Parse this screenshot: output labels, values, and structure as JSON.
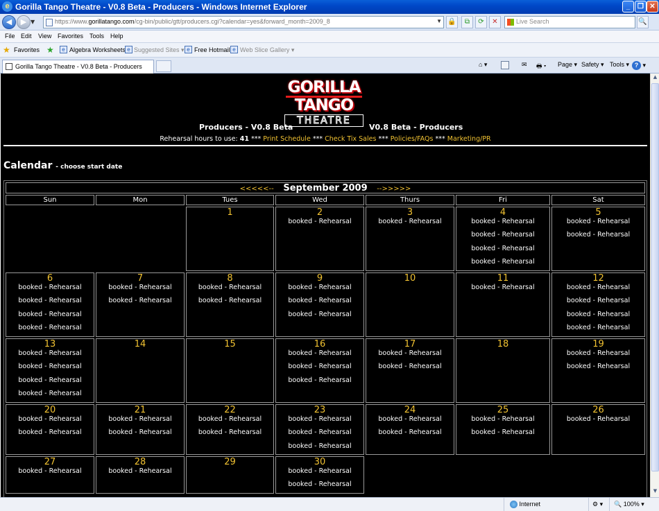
{
  "window": {
    "title": "Gorilla Tango Theatre - V0.8 Beta - Producers - Windows Internet Explorer"
  },
  "address": {
    "scheme": "https://www.",
    "host": "gorillatango.com",
    "path": "/cg-bin/public/gtt/producers.cgi?calendar=yes&forward_month=2009_8"
  },
  "search": {
    "placeholder": "Live Search"
  },
  "menu": [
    "File",
    "Edit",
    "View",
    "Favorites",
    "Tools",
    "Help"
  ],
  "favorites": {
    "label": "Favorites",
    "links": [
      "Algebra Worksheets",
      "Suggested Sites",
      "Free Hotmail",
      "Web Slice Gallery"
    ]
  },
  "tab": {
    "title": "Gorilla Tango Theatre - V0.8 Beta - Producers"
  },
  "toolbar": {
    "page": "Page",
    "safety": "Safety",
    "tools": "Tools"
  },
  "logo": {
    "line1": "GORILLA",
    "line2": "TANGO",
    "line3": "THEATRE"
  },
  "header": {
    "left": "Producers - V0.8 Beta",
    "right": "V0.8 Beta - Producers",
    "hours_label": "Rehearsal hours to use:",
    "hours_value": "41",
    "sep": "***",
    "links": [
      "Print Schedule",
      "Check Tix Sales",
      "Policies/FAQs",
      "Marketing/PR"
    ]
  },
  "calendar": {
    "heading": "Calendar",
    "subheading": "- choose start date",
    "prev": "<<<<<--",
    "next": "-->>>>>",
    "month": "September 2009",
    "days": [
      "Sun",
      "Mon",
      "Tues",
      "Wed",
      "Thurs",
      "Fri",
      "Sat"
    ],
    "booking_text": "booked - Rehearsal",
    "cells": [
      {
        "day": "1",
        "col": 2,
        "row": 0,
        "bookings": 0
      },
      {
        "day": "2",
        "col": 3,
        "row": 0,
        "bookings": 1
      },
      {
        "day": "3",
        "col": 4,
        "row": 0,
        "bookings": 1
      },
      {
        "day": "4",
        "col": 5,
        "row": 0,
        "bookings": 4
      },
      {
        "day": "5",
        "col": 6,
        "row": 0,
        "bookings": 2
      },
      {
        "day": "6",
        "col": 0,
        "row": 1,
        "bookings": 4
      },
      {
        "day": "7",
        "col": 1,
        "row": 1,
        "bookings": 2
      },
      {
        "day": "8",
        "col": 2,
        "row": 1,
        "bookings": 2
      },
      {
        "day": "9",
        "col": 3,
        "row": 1,
        "bookings": 3
      },
      {
        "day": "10",
        "col": 4,
        "row": 1,
        "bookings": 0
      },
      {
        "day": "11",
        "col": 5,
        "row": 1,
        "bookings": 1
      },
      {
        "day": "12",
        "col": 6,
        "row": 1,
        "bookings": 4
      },
      {
        "day": "13",
        "col": 0,
        "row": 2,
        "bookings": 4
      },
      {
        "day": "14",
        "col": 1,
        "row": 2,
        "bookings": 0
      },
      {
        "day": "15",
        "col": 2,
        "row": 2,
        "bookings": 0
      },
      {
        "day": "16",
        "col": 3,
        "row": 2,
        "bookings": 3
      },
      {
        "day": "17",
        "col": 4,
        "row": 2,
        "bookings": 2
      },
      {
        "day": "18",
        "col": 5,
        "row": 2,
        "bookings": 0
      },
      {
        "day": "19",
        "col": 6,
        "row": 2,
        "bookings": 2
      },
      {
        "day": "20",
        "col": 0,
        "row": 3,
        "bookings": 2
      },
      {
        "day": "21",
        "col": 1,
        "row": 3,
        "bookings": 2
      },
      {
        "day": "22",
        "col": 2,
        "row": 3,
        "bookings": 2
      },
      {
        "day": "23",
        "col": 3,
        "row": 3,
        "bookings": 3
      },
      {
        "day": "24",
        "col": 4,
        "row": 3,
        "bookings": 2
      },
      {
        "day": "25",
        "col": 5,
        "row": 3,
        "bookings": 2
      },
      {
        "day": "26",
        "col": 6,
        "row": 3,
        "bookings": 1
      },
      {
        "day": "27",
        "col": 0,
        "row": 4,
        "bookings": 1
      },
      {
        "day": "28",
        "col": 1,
        "row": 4,
        "bookings": 1
      },
      {
        "day": "29",
        "col": 2,
        "row": 4,
        "bookings": 0
      },
      {
        "day": "30",
        "col": 3,
        "row": 4,
        "bookings": 2
      }
    ]
  },
  "status": {
    "zone": "Internet",
    "zoom": "100%"
  },
  "colors": {
    "accent": "#f1c232",
    "page_bg": "#000000",
    "logo_red": "#e31b1b"
  }
}
